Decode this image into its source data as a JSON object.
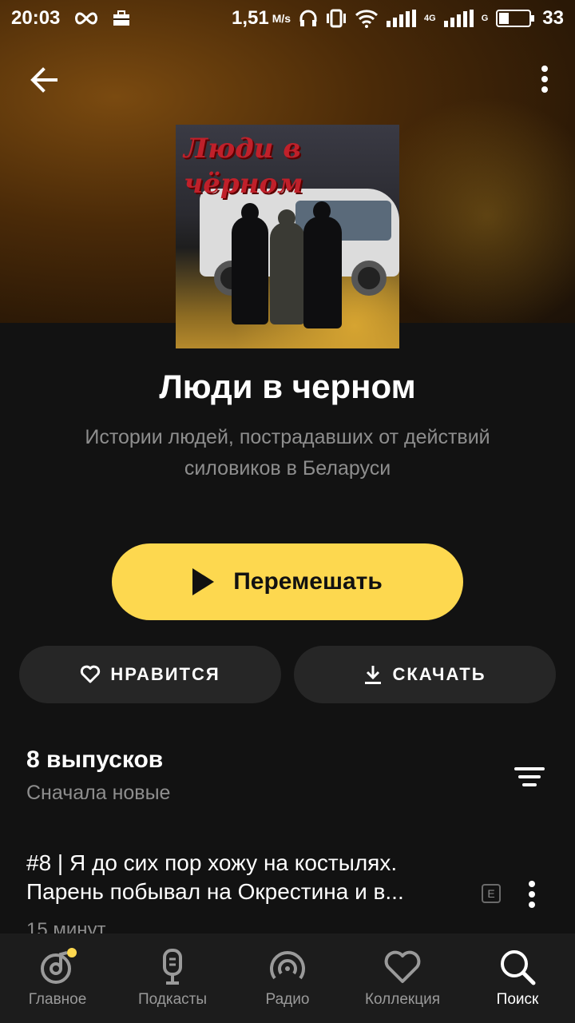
{
  "status_bar": {
    "time": "20:03",
    "speed": "1,51",
    "speed_unit": "M/s",
    "net_4g": "4G",
    "net_g": "G",
    "battery": "33"
  },
  "podcast": {
    "cover_title_line1": "Люди в",
    "cover_title_line2": "чёрном",
    "title": "Люди в черном",
    "description": "Истории людей, пострадавших от действий силовиков в Беларуси"
  },
  "actions": {
    "shuffle_label": "Перемешать",
    "like_label": "НРАВИТСЯ",
    "download_label": "СКАЧАТЬ"
  },
  "episodes": {
    "count_label": "8 выпусков",
    "sort_label": "Сначала новые",
    "items": [
      {
        "title_line1": "#8 | Я до сих пор хожу на костылях.",
        "title_line2": "Парень побывал на Окрестина и в...",
        "explicit": "E",
        "duration": "15 минут"
      }
    ]
  },
  "nav": {
    "items": [
      {
        "label": "Главное",
        "icon": "home-disc-icon"
      },
      {
        "label": "Подкасты",
        "icon": "microphone-icon"
      },
      {
        "label": "Радио",
        "icon": "radio-icon"
      },
      {
        "label": "Коллекция",
        "icon": "heart-icon"
      },
      {
        "label": "Поиск",
        "icon": "search-icon"
      }
    ],
    "active": "Поиск"
  },
  "colors": {
    "accent": "#fdd84f",
    "background": "#121212",
    "pill": "#262626",
    "muted_text": "#8e8e8e"
  }
}
